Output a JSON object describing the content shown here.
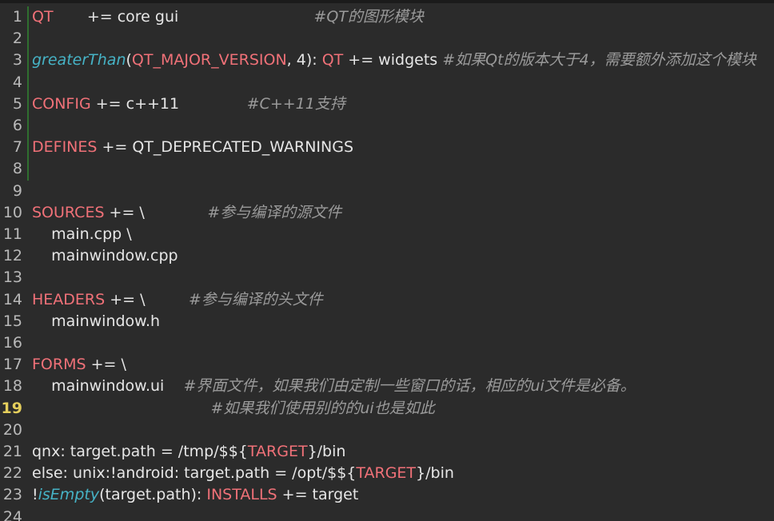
{
  "editor": {
    "active_line": 19,
    "colors": {
      "background": "#2b2b2b",
      "keyword": "#f07178",
      "function": "#46b3c6",
      "comment": "#9a9a9a",
      "text": "#e6e6e6",
      "active_line_number": "#e5cf5c",
      "gutter_change_marker": "#2f6e2f"
    },
    "lines": [
      {
        "n": "1",
        "tokens": [
          {
            "t": "kw",
            "v": "QT"
          },
          {
            "t": "pl",
            "v": "       += core gui                            "
          },
          {
            "t": "cm",
            "v": "#QT的图形模块"
          }
        ]
      },
      {
        "n": "2",
        "tokens": []
      },
      {
        "n": "3",
        "tokens": [
          {
            "t": "fn",
            "v": "greaterThan"
          },
          {
            "t": "pl",
            "v": "("
          },
          {
            "t": "kw",
            "v": "QT_MAJOR_VERSION"
          },
          {
            "t": "pl",
            "v": ", 4): "
          },
          {
            "t": "kw",
            "v": "QT"
          },
          {
            "t": "pl",
            "v": " += widgets "
          },
          {
            "t": "cm",
            "v": "#如果Qt的版本大于4，需要额外添加这个模块"
          }
        ]
      },
      {
        "n": "4",
        "tokens": []
      },
      {
        "n": "5",
        "tokens": [
          {
            "t": "kw",
            "v": "CONFIG"
          },
          {
            "t": "pl",
            "v": " += c++11              "
          },
          {
            "t": "cm",
            "v": "#C++11支持"
          }
        ]
      },
      {
        "n": "6",
        "tokens": []
      },
      {
        "n": "7",
        "tokens": [
          {
            "t": "kw",
            "v": "DEFINES"
          },
          {
            "t": "pl",
            "v": " += QT_DEPRECATED_WARNINGS"
          }
        ]
      },
      {
        "n": "8",
        "tokens": []
      },
      {
        "n": "9",
        "tokens": []
      },
      {
        "n": "10",
        "tokens": [
          {
            "t": "kw",
            "v": "SOURCES"
          },
          {
            "t": "pl",
            "v": " += \\             "
          },
          {
            "t": "cm",
            "v": "#参与编译的源文件"
          }
        ]
      },
      {
        "n": "11",
        "tokens": [
          {
            "t": "pl",
            "v": "    main.cpp \\"
          }
        ]
      },
      {
        "n": "12",
        "tokens": [
          {
            "t": "pl",
            "v": "    mainwindow.cpp"
          }
        ]
      },
      {
        "n": "13",
        "tokens": []
      },
      {
        "n": "14",
        "tokens": [
          {
            "t": "kw",
            "v": "HEADERS"
          },
          {
            "t": "pl",
            "v": " += \\         "
          },
          {
            "t": "cm",
            "v": "#参与编译的头文件"
          }
        ]
      },
      {
        "n": "15",
        "tokens": [
          {
            "t": "pl",
            "v": "    mainwindow.h"
          }
        ]
      },
      {
        "n": "16",
        "tokens": []
      },
      {
        "n": "17",
        "tokens": [
          {
            "t": "kw",
            "v": "FORMS"
          },
          {
            "t": "pl",
            "v": " += \\"
          }
        ]
      },
      {
        "n": "18",
        "tokens": [
          {
            "t": "pl",
            "v": "    mainwindow.ui    "
          },
          {
            "t": "cm",
            "v": "#界面文件，如果我们由定制一些窗口的话，相应的ui文件是必备。"
          }
        ]
      },
      {
        "n": "19",
        "tokens": [
          {
            "t": "pl",
            "v": "                                     "
          },
          {
            "t": "cm",
            "v": "#如果我们使用别的的ui也是如此"
          }
        ]
      },
      {
        "n": "20",
        "tokens": []
      },
      {
        "n": "21",
        "tokens": [
          {
            "t": "pl",
            "v": "qnx: target.path = /tmp/$${"
          },
          {
            "t": "kw",
            "v": "TARGET"
          },
          {
            "t": "pl",
            "v": "}/bin"
          }
        ]
      },
      {
        "n": "22",
        "tokens": [
          {
            "t": "pl",
            "v": "else: unix:!android: target.path = /opt/$${"
          },
          {
            "t": "kw",
            "v": "TARGET"
          },
          {
            "t": "pl",
            "v": "}/bin"
          }
        ]
      },
      {
        "n": "23",
        "tokens": [
          {
            "t": "pl",
            "v": "!"
          },
          {
            "t": "fn",
            "v": "isEmpty"
          },
          {
            "t": "pl",
            "v": "(target.path): "
          },
          {
            "t": "kw",
            "v": "INSTALLS"
          },
          {
            "t": "pl",
            "v": " += target"
          }
        ]
      },
      {
        "n": "24",
        "tokens": []
      }
    ]
  }
}
